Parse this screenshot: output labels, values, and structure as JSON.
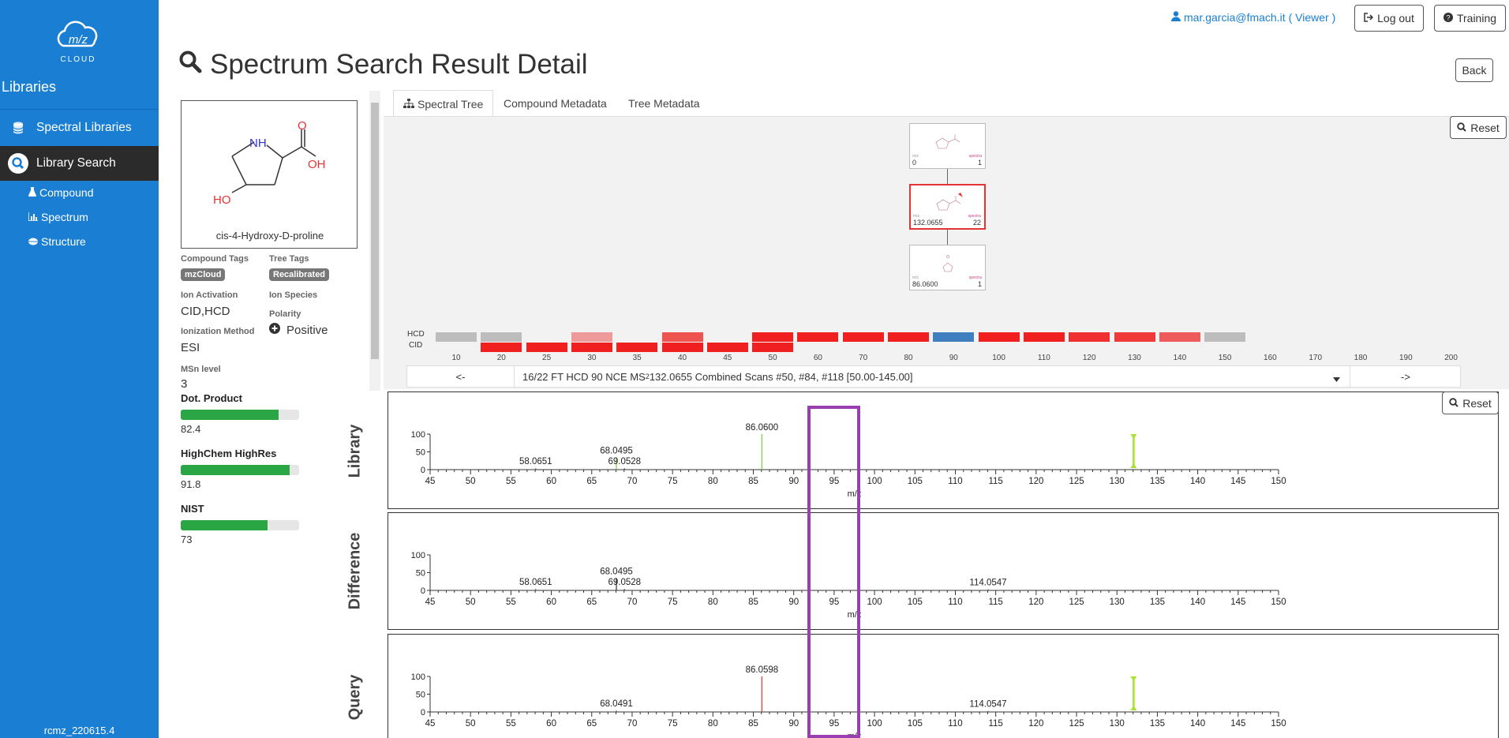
{
  "sidebar": {
    "logo_text": "m/z",
    "logo_sub": "CLOUD",
    "section_title": "Libraries",
    "items": [
      {
        "label": "Spectral Libraries"
      },
      {
        "label": "Library Search"
      }
    ],
    "subitems": [
      {
        "label": "Compound"
      },
      {
        "label": "Spectrum"
      },
      {
        "label": "Structure"
      }
    ],
    "version": "rcmz_220615.4"
  },
  "header": {
    "user": "mar.garcia@fmach.it",
    "role": "( Viewer )",
    "logout": "Log out",
    "training": "Training",
    "title": "Spectrum Search Result Detail",
    "back": "Back"
  },
  "compound": {
    "name": "cis-4-Hydroxy-D-proline",
    "atoms": {
      "nh": "NH",
      "o": "O",
      "oh": "OH",
      "ho": "HO"
    },
    "compound_tags_label": "Compound Tags",
    "compound_tag": "mzCloud",
    "tree_tags_label": "Tree Tags",
    "tree_tag": "Recalibrated",
    "ion_activation_label": "Ion Activation",
    "ion_activation": "CID,HCD",
    "ion_species_label": "Ion Species",
    "polarity_label": "Polarity",
    "polarity": "Positive",
    "ionization_label": "Ionization Method",
    "ionization": "ESI",
    "msn_label": "MSn level",
    "msn": "3"
  },
  "scores": [
    {
      "label": "Dot. Product",
      "value": "82.4",
      "fraction": 0.824
    },
    {
      "label": "HighChem HighRes",
      "value": "91.8",
      "fraction": 0.918
    },
    {
      "label": "NIST",
      "value": "73",
      "fraction": 0.73
    }
  ],
  "tabs": [
    {
      "label": "Spectral Tree"
    },
    {
      "label": "Compound Metadata"
    },
    {
      "label": "Tree Metadata"
    }
  ],
  "reset": "Reset",
  "tree": {
    "nodes": [
      {
        "mz": "0",
        "spectra": "1",
        "mz_tag": "m/z",
        "spectra_tag": "spectra"
      },
      {
        "mz": "132.0655",
        "spectra": "22",
        "mz_tag": "m/z",
        "spectra_tag": "spectra"
      },
      {
        "mz": "86.0600",
        "spectra": "1",
        "mz_tag": "m/z",
        "spectra_tag": "spectra"
      }
    ]
  },
  "heatmap": {
    "hcd_label": "HCD",
    "cid_label": "CID",
    "ticks": [
      "10",
      "20",
      "25",
      "30",
      "35",
      "40",
      "45",
      "50",
      "60",
      "70",
      "80",
      "90",
      "100",
      "110",
      "120",
      "130",
      "140",
      "150",
      "160",
      "170",
      "180",
      "190",
      "200"
    ],
    "hcd_colors": [
      "#bdbdbd",
      "#bdbdbd",
      "",
      "#ef9a9a",
      "",
      "#ef5350",
      "",
      "#f02020",
      "#f02020",
      "#f02020",
      "#f02020",
      "#3f7fbf",
      "#f02020",
      "#f02020",
      "#f03030",
      "#f03a3a",
      "#ef5b5b",
      "#bdbdbd",
      "",
      "",
      "",
      "",
      ""
    ],
    "cid_colors": [
      "",
      "#f02020",
      "#f02020",
      "#f02020",
      "#f02020",
      "#f02020",
      "#f02020",
      "#f02020",
      "",
      "",
      "",
      "",
      "",
      "",
      "",
      "",
      "",
      "",
      "",
      "",
      "",
      "",
      ""
    ]
  },
  "nav": {
    "prev": "<-",
    "next": "->",
    "scan_a": "16/22 FT HCD 90 NCE MS",
    "scan_sup": "2",
    "scan_b": " 132.0655 Combined Scans #50, #84, #118 [50.00-145.00]"
  },
  "chart_data": [
    {
      "type": "bar",
      "title": "Library",
      "xlabel": "m/z",
      "xlim": [
        45,
        150
      ],
      "ylim": [
        0,
        100
      ],
      "yticks": [
        0,
        50,
        100
      ],
      "xticks": [
        45,
        50,
        55,
        60,
        65,
        70,
        75,
        80,
        85,
        90,
        95,
        100,
        105,
        110,
        115,
        120,
        125,
        130,
        135,
        140,
        145,
        150
      ],
      "peaks": [
        {
          "mz": 58.0651,
          "intensity": 4,
          "label": "58.0651",
          "color": "#555"
        },
        {
          "mz": 68.0495,
          "intensity": 35,
          "label": "68.0495",
          "color": "#7ac943"
        },
        {
          "mz": 69.0528,
          "intensity": 4,
          "label": "69.0528",
          "color": "#555"
        },
        {
          "mz": 86.06,
          "intensity": 100,
          "label": "86.0600",
          "color": "#7ac943"
        }
      ],
      "precursor_mz": 132.0655
    },
    {
      "type": "bar",
      "title": "Difference",
      "xlabel": "m/z",
      "xlim": [
        45,
        150
      ],
      "ylim": [
        0,
        100
      ],
      "yticks": [
        0,
        50,
        100
      ],
      "xticks": [
        45,
        50,
        55,
        60,
        65,
        70,
        75,
        80,
        85,
        90,
        95,
        100,
        105,
        110,
        115,
        120,
        125,
        130,
        135,
        140,
        145,
        150
      ],
      "peaks": [
        {
          "mz": 58.0651,
          "intensity": 4,
          "label": "58.0651",
          "color": "#555"
        },
        {
          "mz": 68.0495,
          "intensity": 35,
          "label": "68.0495",
          "color": "#333"
        },
        {
          "mz": 69.0528,
          "intensity": 4,
          "label": "69.0528",
          "color": "#555"
        },
        {
          "mz": 114.0547,
          "intensity": 3,
          "label": "114.0547",
          "color": "#555"
        }
      ]
    },
    {
      "type": "bar",
      "title": "Query",
      "xlabel": "m/z",
      "xlim": [
        45,
        150
      ],
      "ylim": [
        0,
        100
      ],
      "yticks": [
        0,
        50,
        100
      ],
      "xticks": [
        45,
        50,
        55,
        60,
        65,
        70,
        75,
        80,
        85,
        90,
        95,
        100,
        105,
        110,
        115,
        120,
        125,
        130,
        135,
        140,
        145,
        150
      ],
      "peaks": [
        {
          "mz": 68.0491,
          "intensity": 4,
          "label": "68.0491",
          "color": "#555"
        },
        {
          "mz": 86.0598,
          "intensity": 100,
          "label": "86.0598",
          "color": "#e53333"
        },
        {
          "mz": 114.0547,
          "intensity": 3,
          "label": "114.0547",
          "color": "#555"
        }
      ],
      "precursor_mz": 132.0655
    }
  ]
}
